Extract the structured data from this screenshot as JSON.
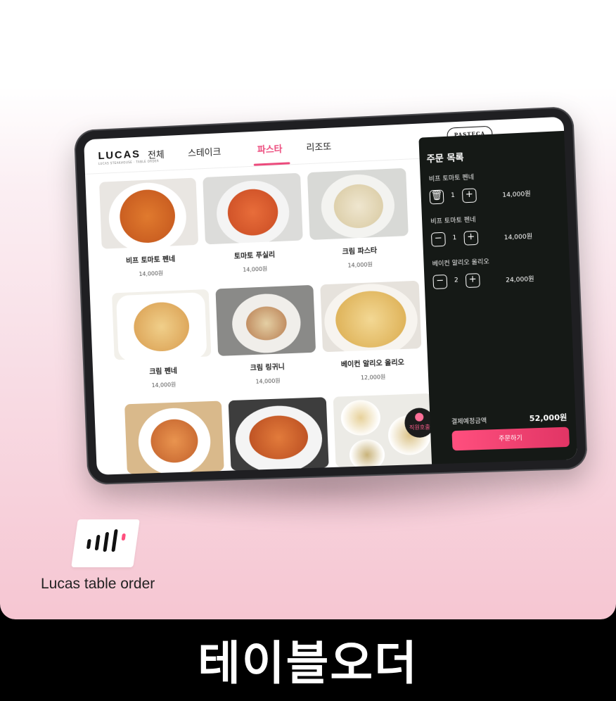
{
  "app": {
    "logo": "LUCAS",
    "logo_sub": "LUCAS STEAKHOUSE · TABLE ORDER"
  },
  "tabs": [
    {
      "label": "전체",
      "active": false
    },
    {
      "label": "스테이크",
      "active": false
    },
    {
      "label": "파스타",
      "active": true
    },
    {
      "label": "리조또",
      "active": false
    }
  ],
  "menu": [
    {
      "name": "비프 토마토 펜네",
      "price": "14,000원",
      "icon": "penne-tomato-dish"
    },
    {
      "name": "토마토 푸실리",
      "price": "14,000원",
      "icon": "fusilli-tomato-dish"
    },
    {
      "name": "크림 파스타",
      "price": "14,000원",
      "icon": "cream-pasta-dish"
    },
    {
      "name": "크림 펜네",
      "price": "14,000원",
      "icon": "cream-penne-dish"
    },
    {
      "name": "크림 링귀니",
      "price": "14,000원",
      "icon": "cream-linguine-dish"
    },
    {
      "name": "베이컨 알리오 올리오",
      "price": "12,000원",
      "icon": "aglio-olio-dish"
    },
    {
      "name": "",
      "price": "",
      "icon": "shrimp-spaghetti-dish"
    },
    {
      "name": "",
      "price": "",
      "icon": "tagliatelle-dish"
    },
    {
      "name": "",
      "price": "",
      "icon": "pasta-spread-dish"
    }
  ],
  "staff_call": {
    "label": "직원호출",
    "icon": "bell-icon"
  },
  "order_panel": {
    "badge": "PASTECA",
    "title": "주문 목록",
    "items": [
      {
        "name": "비프 토마토 펜네",
        "qty": "1",
        "price": "14,000원",
        "minus_icon": "trash-icon"
      },
      {
        "name": "비프 토마토 펜네",
        "qty": "1",
        "price": "14,000원",
        "minus_icon": "minus-icon"
      },
      {
        "name": "베이컨 알리오 올리오",
        "qty": "2",
        "price": "24,000원",
        "minus_icon": "minus-icon"
      }
    ],
    "total_label": "결제예정금액",
    "total_value": "52,000원",
    "order_button": "주문하기"
  },
  "brand": {
    "name": "Lucas table order"
  },
  "footer": {
    "title": "테이블오더"
  },
  "colors": {
    "accent": "#ec4a7c",
    "panel_bg": "#151916",
    "button": "#ff4f7e"
  }
}
